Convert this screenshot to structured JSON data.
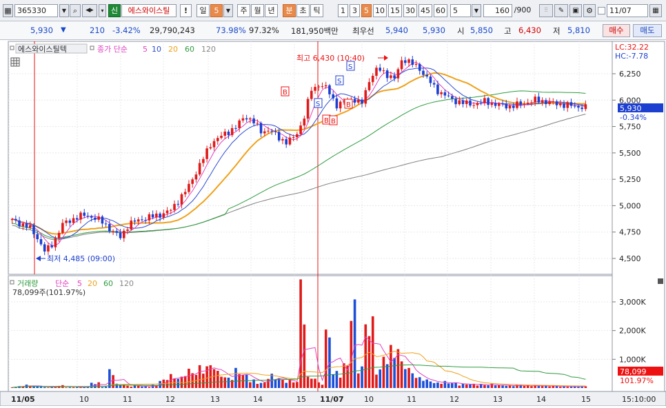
{
  "toolbar": {
    "code": "365330",
    "name_badge": "신",
    "name": "에스와이스틸",
    "alert": "!",
    "day": "일",
    "day_num": "5",
    "week": "주",
    "month": "월",
    "year": "년",
    "minute": "분",
    "second": "초",
    "tick": "틱",
    "intervals": [
      "1",
      "3",
      "5",
      "10",
      "15",
      "30",
      "45",
      "60"
    ],
    "interval_input": "5",
    "count": "160",
    "count_total": "/900",
    "date": "11/07"
  },
  "quote": {
    "price": "5,930",
    "change": "210",
    "change_pct": "-3.42%",
    "volume": "29,790,243",
    "turnover1": "73.98%",
    "turnover2": "97.32%",
    "amount": "181,950백만",
    "best_label": "최우선",
    "ask": "5,940",
    "bid": "5,930",
    "open_label": "시",
    "open": "5,850",
    "high_label": "고",
    "high": "6,430",
    "low_label": "저",
    "low": "5,810",
    "buy_button": "매수",
    "sell_button": "매도"
  },
  "price_panel": {
    "name": "에스와이스틸텍",
    "ma_label": "종가 단순",
    "ma_periods": [
      "5",
      "10",
      "20",
      "60",
      "120"
    ],
    "lc": "LC:32.22",
    "hc": "HC:-7.78",
    "current_price": "5,930",
    "current_pct": "-0.34%",
    "high_annotation": "최고 6,430 (10:40)",
    "low_annotation": "최저 4,485 (09:00)"
  },
  "volume_panel": {
    "label": "거래량",
    "ma_label": "단순",
    "ma_periods": [
      "5",
      "20",
      "60",
      "120"
    ],
    "current": "78,099주(101.97%)",
    "current_value": "78,099",
    "current_pct": "101.97%"
  },
  "time_axis": {
    "labels": [
      "11/05",
      "10",
      "11",
      "12",
      "13",
      "14",
      "15",
      "11/07",
      "10",
      "11",
      "12",
      "13",
      "14",
      "15"
    ],
    "clock": "15:10:00"
  },
  "chart_data": {
    "type": "candlestick",
    "y_ticks": [
      "6,250",
      "6,000",
      "5,750",
      "5,500",
      "5,250",
      "5,000",
      "4,750",
      "4,500"
    ],
    "y_tick_values": [
      6250,
      6000,
      5750,
      5500,
      5250,
      5000,
      4750,
      4500
    ],
    "volume_ticks": [
      "3,000K",
      "2,000K",
      "1,000K"
    ],
    "volume_tick_values": [
      3000,
      2000,
      1000
    ],
    "close_path": [
      4860,
      4830,
      4800,
      4700,
      4560,
      4650,
      4820,
      4860,
      4900,
      4910,
      4880,
      4840,
      4760,
      4700,
      4820,
      4860,
      4880,
      4900,
      4920,
      4950,
      5050,
      5150,
      5300,
      5450,
      5600,
      5650,
      5700,
      5750,
      5850,
      5800,
      5700,
      5720,
      5650,
      5600,
      5650,
      5800,
      6100,
      6150,
      6100,
      5950,
      5980,
      6020,
      5950,
      6200,
      6300,
      6250,
      6200,
      6400,
      6350,
      6300,
      6200,
      6100,
      6050,
      6000,
      5980,
      5960,
      5970,
      5990,
      5960,
      5950,
      5940,
      5960,
      5980,
      6000,
      5990,
      5970,
      5960,
      5950,
      5940,
      5930
    ],
    "volume_path_k": [
      40,
      80,
      120,
      60,
      30,
      50,
      100,
      30,
      40,
      60,
      200,
      50,
      700,
      150,
      80,
      100,
      60,
      120,
      300,
      500,
      400,
      700,
      600,
      800,
      900,
      600,
      400,
      700,
      500,
      300,
      200,
      500,
      400,
      300,
      250,
      3900,
      400,
      200,
      2100,
      600,
      900,
      3100,
      800,
      2500,
      700,
      1200,
      1500,
      1000,
      700,
      400,
      300,
      200,
      250,
      200,
      150,
      150,
      150,
      120,
      150,
      100,
      100,
      120,
      100,
      80,
      100,
      80,
      70,
      60,
      70,
      78
    ]
  }
}
